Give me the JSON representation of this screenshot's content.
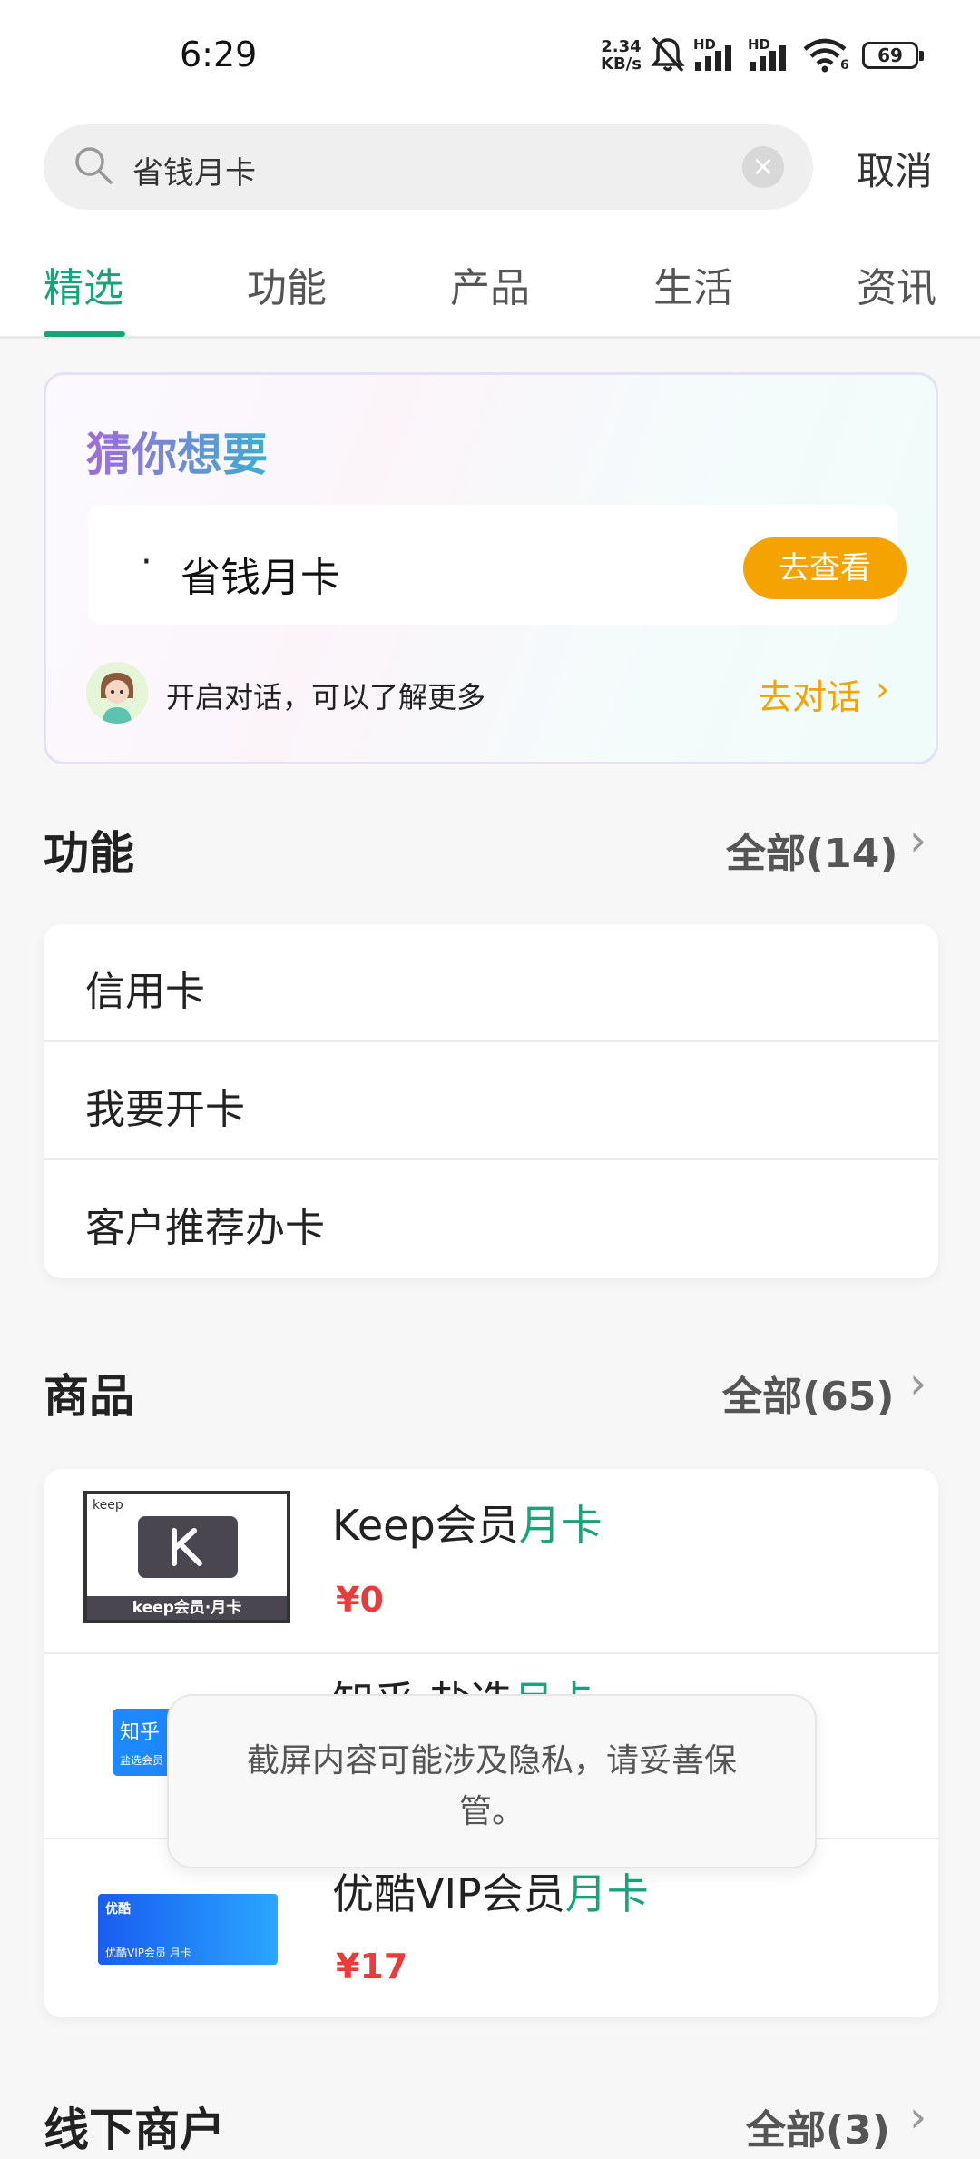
{
  "status_bar": {
    "time": "6:29",
    "net_speed_value": "2.34",
    "net_speed_unit": "KB/s",
    "battery": "69",
    "signal_label_1": "HD",
    "signal_label_2": "HD",
    "wifi_label": "6"
  },
  "search": {
    "query": "省钱月卡",
    "cancel_label": "取消"
  },
  "tabs": [
    {
      "label": "精选",
      "active": true
    },
    {
      "label": "功能",
      "active": false
    },
    {
      "label": "产品",
      "active": false
    },
    {
      "label": "生活",
      "active": false
    },
    {
      "label": "资讯",
      "active": false
    }
  ],
  "guess": {
    "title": "猜你想要",
    "item_text": "省钱月卡",
    "item_button": "去查看",
    "chat_hint": "开启对话，可以了解更多",
    "chat_link": "去对话"
  },
  "functions": {
    "title": "功能",
    "more": "全部(14)",
    "items": [
      "信用卡",
      "我要开卡",
      "客户推荐办卡"
    ]
  },
  "goods": {
    "title": "商品",
    "more": "全部(65)",
    "items": [
      {
        "name": "Keep会员",
        "highlight": "月卡",
        "price": "¥0",
        "thumb_caption": "keep会员·月卡",
        "thumb_brand": "keep"
      },
      {
        "name": "知乎·盐选",
        "highlight": "月卡",
        "price": "",
        "thumb_brand": "知乎",
        "thumb_caption": "盐选会员"
      },
      {
        "name": "优酷VIP会员",
        "highlight": "月卡",
        "price": "¥17",
        "thumb_brand": "优酷",
        "thumb_caption": "优酷VIP会员 月卡"
      }
    ]
  },
  "offline": {
    "title": "线下商户",
    "more": "全部(3)"
  },
  "toast": {
    "text": "截屏内容可能涉及隐私，请妥善保管。"
  },
  "colors": {
    "accent": "#1aa37a",
    "orange": "#f5a300",
    "price": "#e83b3b"
  }
}
